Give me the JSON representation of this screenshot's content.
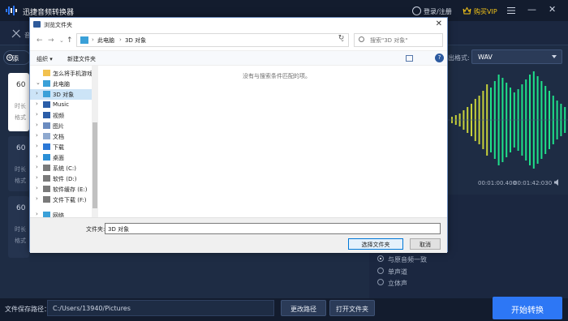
{
  "app": {
    "title": "迅捷音频转换器",
    "login": "登录/注册",
    "vip": "购买VIP",
    "win_min": "—",
    "win_close": "✕",
    "toolbar_text": "音",
    "add_button": "添",
    "colors": {
      "header_bg": "#131c2e",
      "body_bg": "#1e2c44",
      "accent": "#2d77f5",
      "vip": "#f5c518",
      "wave": "#1fe08a"
    }
  },
  "cards": [
    {
      "duration": "60",
      "meta1": "时长",
      "meta2": "格式"
    },
    {
      "duration": "60",
      "meta1": "时长",
      "meta2": "格式"
    },
    {
      "duration": "60",
      "meta1": "时长",
      "meta2": "格式"
    }
  ],
  "output_format": {
    "label": "出格式:",
    "value": "WAV"
  },
  "player": {
    "current": "00:01:00.400",
    "total": "00:01:42:030"
  },
  "channels": [
    {
      "label": "与原音频一致",
      "selected": true
    },
    {
      "label": "单声道",
      "selected": false
    },
    {
      "label": "立体声",
      "selected": false
    }
  ],
  "footer": {
    "save_label": "文件保存路径：",
    "save_path": "C:/Users/13940/Pictures",
    "change_path": "更改路径",
    "open_folder": "打开文件夹",
    "start": "开始转换"
  },
  "dialog": {
    "title": "浏览文件夹",
    "close": "✕",
    "address": [
      "此电脑",
      "3D 对象"
    ],
    "search_placeholder": "搜索\"3D 对象\"",
    "organize": "组织 ▾",
    "new_folder": "新建文件夹",
    "empty_message": "没有与搜索条件匹配的项。",
    "nav_items": [
      {
        "label": "怎么将手机游戏",
        "icon": "folder-icon",
        "expand": ""
      },
      {
        "label": "此电脑",
        "icon": "computer-icon",
        "expand": "⌄"
      },
      {
        "label": "3D 对象",
        "icon": "3d-objects-icon",
        "expand": "›",
        "selected": true
      },
      {
        "label": "Music",
        "icon": "music-icon",
        "expand": "›"
      },
      {
        "label": "视频",
        "icon": "video-icon",
        "expand": "›"
      },
      {
        "label": "图片",
        "icon": "pictures-icon",
        "expand": "›"
      },
      {
        "label": "文档",
        "icon": "documents-icon",
        "expand": "›"
      },
      {
        "label": "下载",
        "icon": "downloads-icon",
        "expand": "›"
      },
      {
        "label": "桌面",
        "icon": "desktop-icon",
        "expand": "›"
      },
      {
        "label": "系统 (C:)",
        "icon": "drive-icon",
        "expand": "›"
      },
      {
        "label": "软件 (D:)",
        "icon": "drive-icon",
        "expand": "›"
      },
      {
        "label": "软件缓存 (E:)",
        "icon": "drive-icon",
        "expand": "›"
      },
      {
        "label": "文件下载 (F:)",
        "icon": "drive-icon",
        "expand": "›"
      },
      {
        "label": "网络",
        "icon": "network-icon",
        "expand": "›"
      }
    ],
    "filename_label": "文件夹:",
    "filename_value": "3D 对象",
    "select_button": "选择文件夹",
    "cancel_button": "取消"
  }
}
